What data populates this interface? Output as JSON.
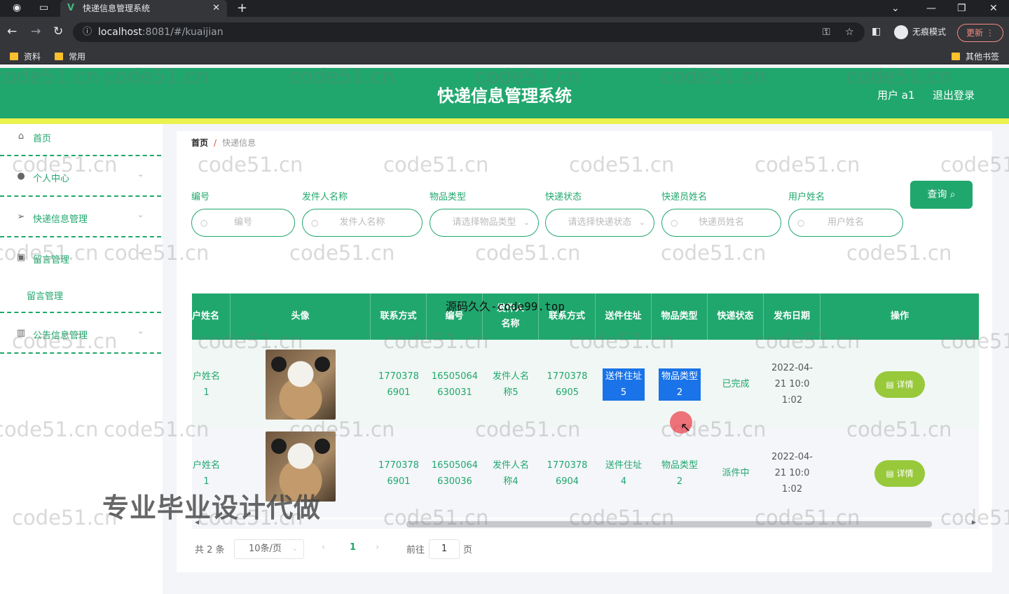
{
  "browser": {
    "tab_title": "快递信息管理系统",
    "url_host": "localhost",
    "url_path": ":8081/#/kuaijian",
    "incognito_label": "无痕模式",
    "update_label": "更新",
    "bookmarks": [
      "资料",
      "常用"
    ],
    "other_bookmarks": "其他书签"
  },
  "header": {
    "title": "快递信息管理系统",
    "user": "用户 a1",
    "logout": "退出登录"
  },
  "sidebar": {
    "items": [
      {
        "label": "首页",
        "icon": "home-icon"
      },
      {
        "label": "个人中心",
        "icon": "user-icon"
      },
      {
        "label": "快递信息管理",
        "icon": "send-icon"
      },
      {
        "label": "留言管理",
        "icon": "message-icon"
      },
      {
        "label": "留言管理",
        "icon": ""
      },
      {
        "label": "公告信息管理",
        "icon": "chart-icon"
      }
    ]
  },
  "breadcrumb": {
    "home": "首页",
    "current": "快递信息",
    "separator": "/"
  },
  "filters": [
    {
      "label": "编号",
      "placeholder": "编号"
    },
    {
      "label": "发件人名称",
      "placeholder": "发件人名称"
    },
    {
      "label": "物品类型",
      "placeholder": "请选择物品类型"
    },
    {
      "label": "快递状态",
      "placeholder": "请选择快递状态"
    },
    {
      "label": "快递员姓名",
      "placeholder": "快递员姓名"
    },
    {
      "label": "用户姓名",
      "placeholder": "用户姓名"
    }
  ],
  "query_label": "查询",
  "table": {
    "columns": [
      "户姓名",
      "头像",
      "联系方式",
      "编号",
      "发件人名称",
      "联系方式",
      "送件住址",
      "物品类型",
      "快递状态",
      "发布日期",
      "操作"
    ],
    "rows": [
      [
        "户姓名1",
        "",
        "17703786901",
        "16505064630031",
        "发件人名称5",
        "17703786905",
        "送件住址5",
        "物品类型2",
        "已完成",
        "2022-04-21 10:01:02",
        "详情"
      ],
      [
        "户姓名1",
        "",
        "17703786901",
        "16505064630036",
        "发件人名称4",
        "17703786904",
        "送件住址4",
        "物品类型2",
        "派件中",
        "2022-04-21 10:01:02",
        "详情"
      ]
    ]
  },
  "pagination": {
    "total": "共 2 条",
    "page_size": "10条/页",
    "current_page": "1",
    "goto_label": "前往",
    "goto_value": "1",
    "page_suffix": "页"
  },
  "overlays": {
    "top": "源码久久-code99.top",
    "ad": "专业毕业设计代做",
    "watermark": "code51.cn"
  },
  "colors": {
    "primary": "#20a76d",
    "accent_bar": "#eaf24d",
    "detail_button": "#97c93a"
  }
}
